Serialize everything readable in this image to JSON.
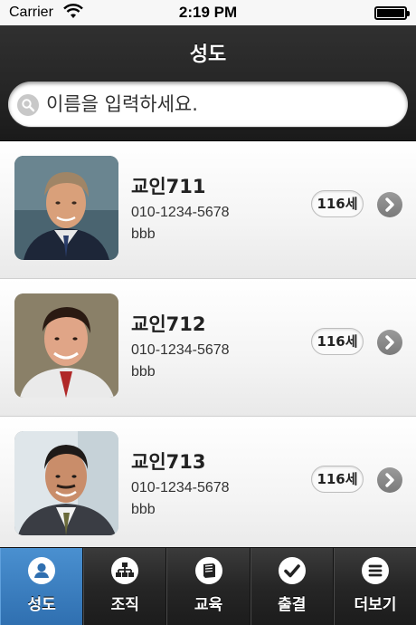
{
  "status_bar": {
    "carrier": "Carrier",
    "time": "2:19 PM"
  },
  "header": {
    "title": "성도"
  },
  "search": {
    "placeholder": "이름을 입력하세요."
  },
  "members": [
    {
      "name": "교인711",
      "phone": "010-1234-5678",
      "note": "bbb",
      "age": "116세",
      "avatar_icon": "member-photo"
    },
    {
      "name": "교인712",
      "phone": "010-1234-5678",
      "note": "bbb",
      "age": "116세",
      "avatar_icon": "member-photo"
    },
    {
      "name": "교인713",
      "phone": "010-1234-5678",
      "note": "bbb",
      "age": "116세",
      "avatar_icon": "member-photo"
    }
  ],
  "tabs": [
    {
      "label": "성도",
      "icon": "person-icon",
      "active": true
    },
    {
      "label": "조직",
      "icon": "org-chart-icon",
      "active": false
    },
    {
      "label": "교육",
      "icon": "book-icon",
      "active": false
    },
    {
      "label": "출결",
      "icon": "check-icon",
      "active": false
    },
    {
      "label": "더보기",
      "icon": "menu-icon",
      "active": false
    }
  ],
  "colors": {
    "header_bg": "#262626",
    "tab_active": "#3a7fc2",
    "chevron": "#8a8a8a"
  }
}
